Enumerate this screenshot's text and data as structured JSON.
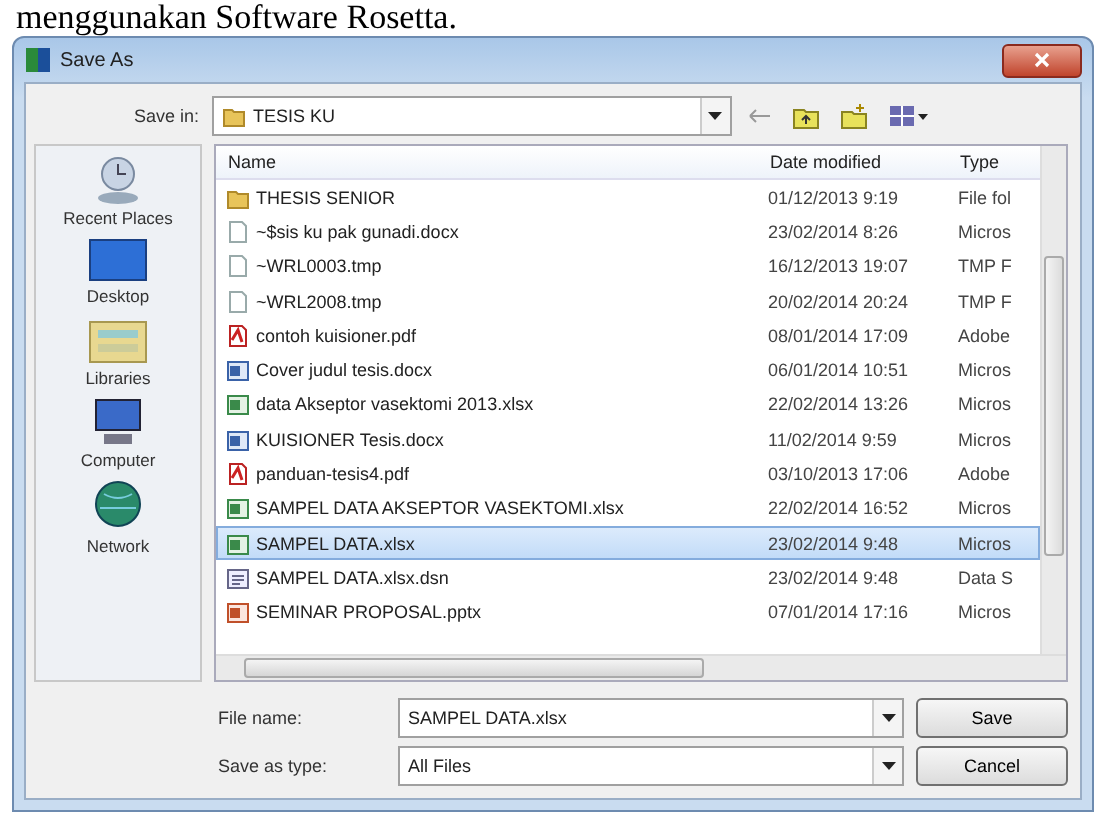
{
  "caption": "menggunakan Software Rosetta.",
  "window": {
    "title": "Save As"
  },
  "save_in": {
    "label": "Save in:",
    "value": "TESIS KU"
  },
  "places": [
    {
      "label": "Recent Places",
      "kind": "recent"
    },
    {
      "label": "Desktop",
      "kind": "desktop"
    },
    {
      "label": "Libraries",
      "kind": "libraries"
    },
    {
      "label": "Computer",
      "kind": "computer"
    },
    {
      "label": "Network",
      "kind": "network"
    }
  ],
  "table": {
    "columns": [
      "Name",
      "Date modified",
      "Type"
    ],
    "rows": [
      {
        "name": "THESIS SENIOR",
        "date": "01/12/2013 9:19",
        "type": "File fol",
        "kind": "folder",
        "selected": false
      },
      {
        "name": "~$sis ku pak gunadi.docx",
        "date": "23/02/2014 8:26",
        "type": "Micros",
        "kind": "doc",
        "selected": false
      },
      {
        "name": "~WRL0003.tmp",
        "date": "16/12/2013 19:07",
        "type": "TMP F",
        "kind": "tmp",
        "selected": false
      },
      {
        "name": "~WRL2008.tmp",
        "date": "20/02/2014 20:24",
        "type": "TMP F",
        "kind": "tmp",
        "selected": false
      },
      {
        "name": "contoh kuisioner.pdf",
        "date": "08/01/2014 17:09",
        "type": "Adobe",
        "kind": "pdf",
        "selected": false
      },
      {
        "name": "Cover judul tesis.docx",
        "date": "06/01/2014 10:51",
        "type": "Micros",
        "kind": "word",
        "selected": false
      },
      {
        "name": "data Akseptor vasektomi 2013.xlsx",
        "date": "22/02/2014 13:26",
        "type": "Micros",
        "kind": "excel",
        "selected": false
      },
      {
        "name": "KUISIONER Tesis.docx",
        "date": "11/02/2014 9:59",
        "type": "Micros",
        "kind": "word",
        "selected": false
      },
      {
        "name": "panduan-tesis4.pdf",
        "date": "03/10/2013 17:06",
        "type": "Adobe",
        "kind": "pdf",
        "selected": false
      },
      {
        "name": "SAMPEL DATA AKSEPTOR VASEKTOMI.xlsx",
        "date": "22/02/2014 16:52",
        "type": "Micros",
        "kind": "excel",
        "selected": false
      },
      {
        "name": "SAMPEL DATA.xlsx",
        "date": "23/02/2014 9:48",
        "type": "Micros",
        "kind": "excel",
        "selected": true
      },
      {
        "name": "SAMPEL DATA.xlsx.dsn",
        "date": "23/02/2014 9:48",
        "type": "Data S",
        "kind": "dsn",
        "selected": false
      },
      {
        "name": "SEMINAR PROPOSAL.pptx",
        "date": "07/01/2014 17:16",
        "type": "Micros",
        "kind": "ppt",
        "selected": false
      }
    ]
  },
  "file_name": {
    "label": "File name:",
    "value": "SAMPEL DATA.xlsx"
  },
  "save_as_type": {
    "label": "Save as type:",
    "value": "All Files"
  },
  "buttons": [
    "Save",
    "Cancel"
  ]
}
